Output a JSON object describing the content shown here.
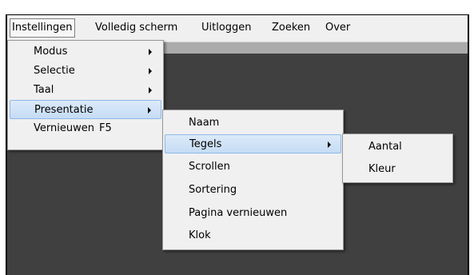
{
  "menubar": {
    "items": [
      {
        "label": "Instellingen"
      },
      {
        "label": "Volledig scherm"
      },
      {
        "label": "Uitloggen"
      },
      {
        "label": "Zoeken"
      },
      {
        "label": "Over"
      }
    ]
  },
  "menu_instellingen": {
    "items": [
      {
        "label": "Modus"
      },
      {
        "label": "Selectie"
      },
      {
        "label": "Taal"
      },
      {
        "label": "Presentatie"
      },
      {
        "label": "Vernieuwen",
        "shortcut": "F5"
      }
    ]
  },
  "menu_presentatie": {
    "items": [
      {
        "label": "Naam"
      },
      {
        "label": "Tegels"
      },
      {
        "label": "Scrollen"
      },
      {
        "label": "Sortering"
      },
      {
        "label": "Pagina vernieuwen"
      },
      {
        "label": "Klok"
      }
    ]
  },
  "menu_tegels": {
    "items": [
      {
        "label": "Aantal"
      },
      {
        "label": "Kleur"
      }
    ]
  },
  "colors": {
    "menubar_bg": "#f0f0f0",
    "strip": "#ababab",
    "content_bg": "#404040",
    "highlight": "#c5dcf5",
    "highlight_border": "#90b8e6"
  }
}
